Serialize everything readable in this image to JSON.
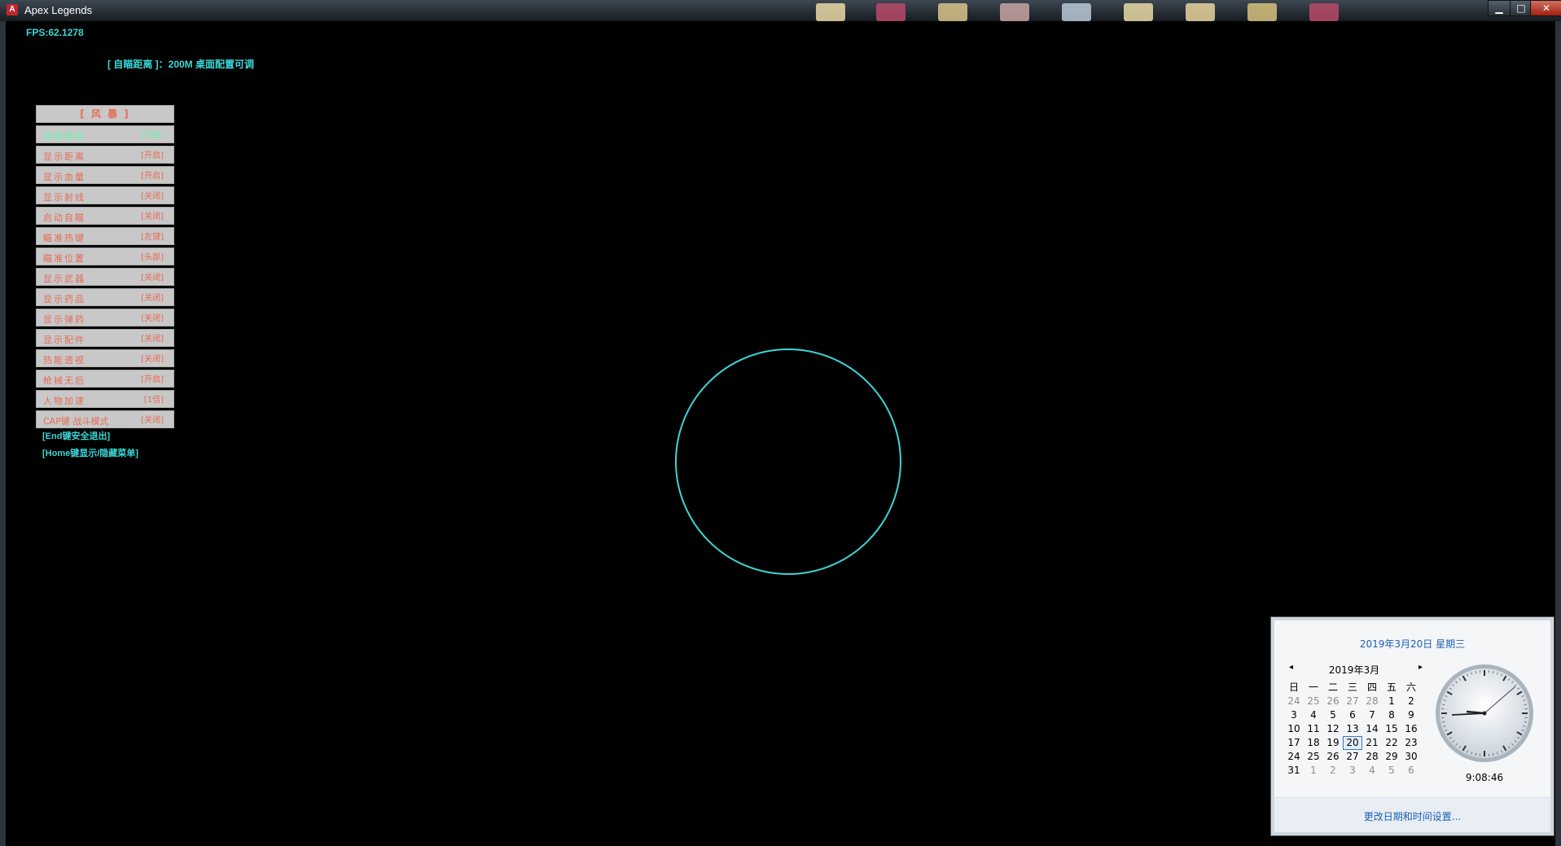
{
  "window": {
    "title": "Apex Legends",
    "app_icon_letter": "A",
    "minimize": "▁",
    "maximize": "□",
    "close": "✕"
  },
  "overlay": {
    "fps": "FPS:62.1278",
    "aim_distance": "[ 自瞄距离 ]：200M  桌面配置可调",
    "menu_title": "[ 风   暴 ]",
    "menu_items": [
      {
        "label": "透视类型",
        "value": "[开启]"
      },
      {
        "label": "显示距离",
        "value": "[开启]"
      },
      {
        "label": "显示血量",
        "value": "[开启]"
      },
      {
        "label": "显示射线",
        "value": "[关闭]"
      },
      {
        "label": "启动自瞄",
        "value": "[关闭]"
      },
      {
        "label": "瞄准热键",
        "value": "[左键]"
      },
      {
        "label": "瞄准位置",
        "value": "[头部]"
      },
      {
        "label": "显示武器",
        "value": "[关闭]"
      },
      {
        "label": "显示药品",
        "value": "[关闭]"
      },
      {
        "label": "显示弹药",
        "value": "[关闭]"
      },
      {
        "label": "显示配件",
        "value": "[关闭]"
      },
      {
        "label": "热能透视",
        "value": "[关闭]"
      },
      {
        "label": "枪械无后",
        "value": "[开启]"
      },
      {
        "label": "人物加速",
        "value": "[1倍]"
      },
      {
        "label": "CAP键 战斗模式",
        "value": "[关闭]"
      }
    ],
    "hint_exit": "[End键安全退出]",
    "hint_toggle": "[Home键显示/隐藏菜单]",
    "accent_color": "#3ad7d7"
  },
  "clock_popup": {
    "date_header": "2019年3月20日 星期三",
    "month_label": "2019年3月",
    "prev": "◂",
    "next": "▸",
    "weekdays": [
      "日",
      "一",
      "二",
      "三",
      "四",
      "五",
      "六"
    ],
    "days": [
      {
        "d": "24",
        "dim": true
      },
      {
        "d": "25",
        "dim": true
      },
      {
        "d": "26",
        "dim": true
      },
      {
        "d": "27",
        "dim": true
      },
      {
        "d": "28",
        "dim": true
      },
      {
        "d": "1"
      },
      {
        "d": "2"
      },
      {
        "d": "3"
      },
      {
        "d": "4"
      },
      {
        "d": "5"
      },
      {
        "d": "6"
      },
      {
        "d": "7"
      },
      {
        "d": "8"
      },
      {
        "d": "9"
      },
      {
        "d": "10"
      },
      {
        "d": "11"
      },
      {
        "d": "12"
      },
      {
        "d": "13"
      },
      {
        "d": "14"
      },
      {
        "d": "15"
      },
      {
        "d": "16"
      },
      {
        "d": "17"
      },
      {
        "d": "18"
      },
      {
        "d": "19"
      },
      {
        "d": "20",
        "today": true
      },
      {
        "d": "21"
      },
      {
        "d": "22"
      },
      {
        "d": "23"
      },
      {
        "d": "24"
      },
      {
        "d": "25"
      },
      {
        "d": "26"
      },
      {
        "d": "27"
      },
      {
        "d": "28"
      },
      {
        "d": "29"
      },
      {
        "d": "30"
      },
      {
        "d": "31"
      },
      {
        "d": "1",
        "dim": true
      },
      {
        "d": "2",
        "dim": true
      },
      {
        "d": "3",
        "dim": true
      },
      {
        "d": "4",
        "dim": true
      },
      {
        "d": "5",
        "dim": true
      },
      {
        "d": "6",
        "dim": true
      }
    ],
    "time": "9:08:46",
    "settings_link": "更改日期和时间设置..."
  }
}
